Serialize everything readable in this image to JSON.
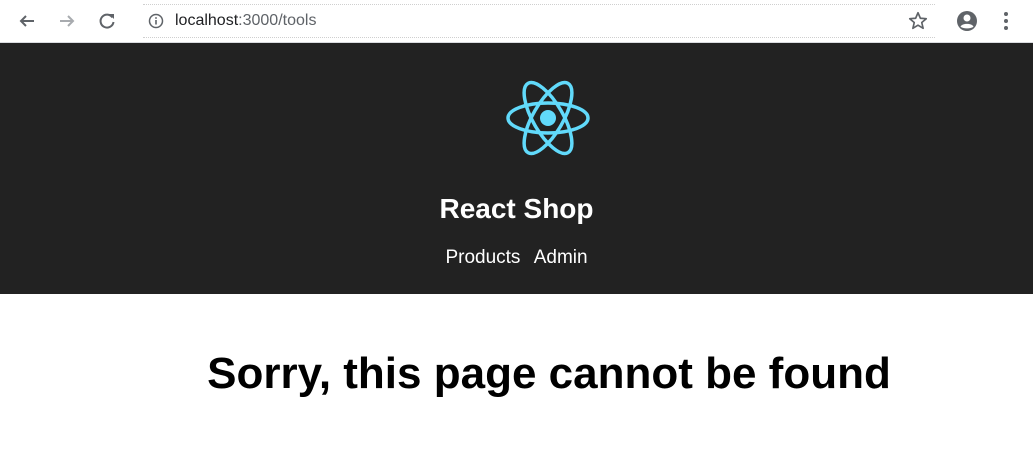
{
  "browser": {
    "url_host": "localhost",
    "url_path": ":3000/tools",
    "icons": [
      "back-arrow-icon",
      "forward-arrow-icon",
      "reload-icon",
      "info-icon",
      "star-icon",
      "account-icon",
      "more-vert-icon"
    ]
  },
  "header": {
    "title": "React Shop",
    "nav": [
      {
        "label": "Products"
      },
      {
        "label": "Admin"
      }
    ],
    "logo_color": "#61dafb",
    "background": "#222222"
  },
  "main": {
    "heading": "Sorry, this page cannot be found"
  }
}
